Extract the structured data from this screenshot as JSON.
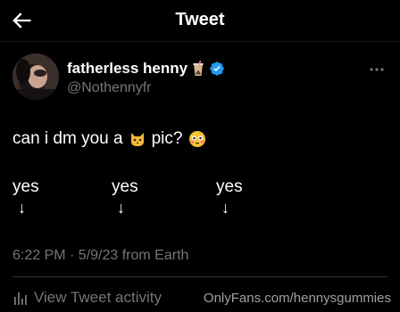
{
  "header": {
    "title": "Tweet"
  },
  "author": {
    "name": "fatherless henny",
    "handle": "@Nothennyfr"
  },
  "tweet": {
    "text_before": "can i dm you a",
    "text_after": "pic?",
    "answers": [
      "yes",
      "yes",
      "yes"
    ],
    "arrow": "↓",
    "timestamp": "6:22 PM · 5/9/23 from Earth"
  },
  "activity": {
    "label": "View Tweet activity"
  },
  "watermark": "OnlyFans.com/hennysgummies",
  "colors": {
    "background": "#000000",
    "text": "#ffffff",
    "muted": "#71767b",
    "verified": "#1d9bf0"
  }
}
